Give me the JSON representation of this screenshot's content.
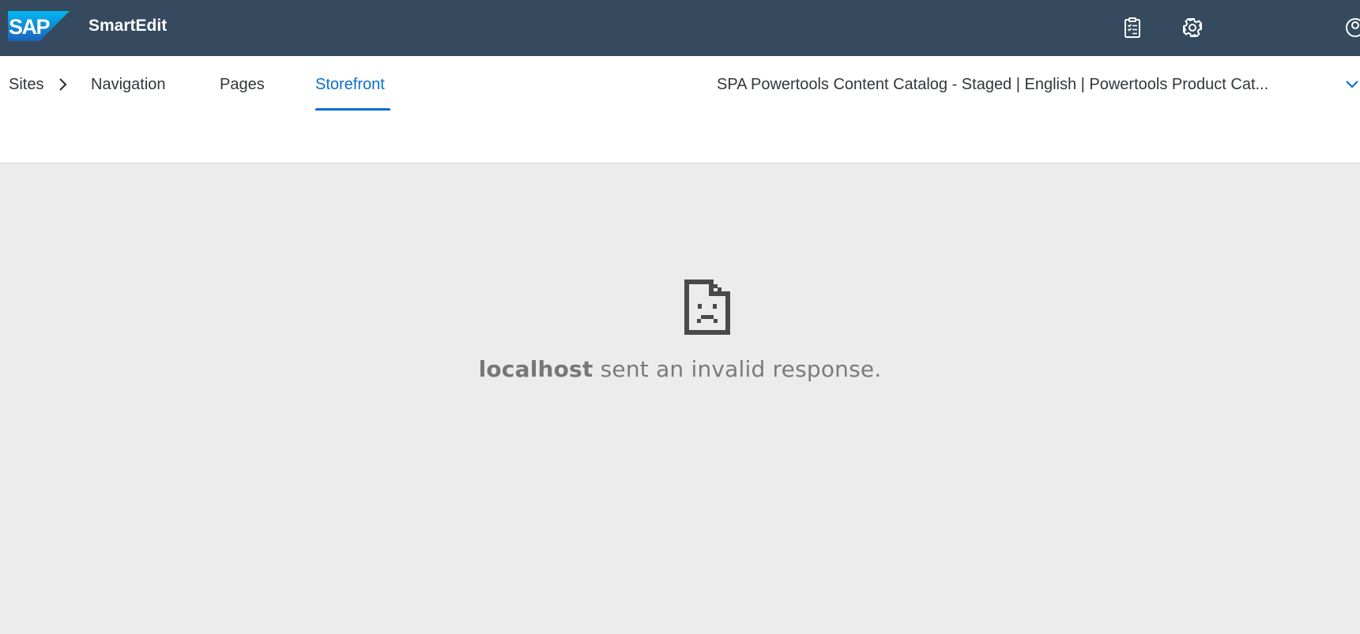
{
  "shellbar": {
    "logo_text": "SAP",
    "app_title": "SmartEdit",
    "background": "#354a5f",
    "actions": [
      {
        "name": "task-list-icon"
      },
      {
        "name": "gear-icon"
      },
      {
        "name": "user-icon"
      }
    ]
  },
  "nav": {
    "sites_label": "Sites",
    "tabs": [
      {
        "label": "Navigation",
        "active": false
      },
      {
        "label": "Pages",
        "active": false
      },
      {
        "label": "Storefront",
        "active": true
      }
    ],
    "context_label": "SPA Powertools Content Catalog - Staged | English | Powertools Product Cat...",
    "accent": "#0a6ed1"
  },
  "error": {
    "icon": "sad-document-icon",
    "host": "localhost",
    "message": "sent an invalid response."
  }
}
